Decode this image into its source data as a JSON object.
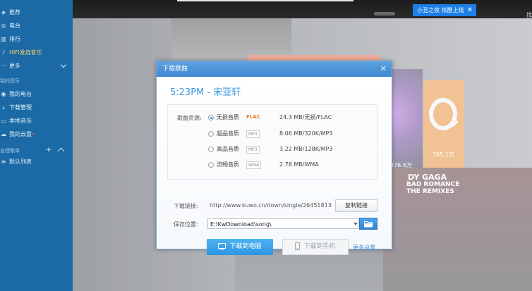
{
  "sidebar": {
    "items_top": [
      {
        "label": "推荐",
        "icon": "tag-icon"
      },
      {
        "label": "电台",
        "icon": "radio-icon"
      },
      {
        "label": "排行",
        "icon": "chart-icon"
      },
      {
        "label": "HiFi发烧音乐",
        "icon": "hifi-icon"
      },
      {
        "label": "更多",
        "icon": "more-icon"
      }
    ],
    "my_music_title": "我的音乐",
    "my_music_items": [
      {
        "label": "我的电台",
        "icon": "radio-icon"
      },
      {
        "label": "下载管理",
        "icon": "download-icon"
      },
      {
        "label": "本地音乐",
        "icon": "monitor-icon"
      },
      {
        "label": "我的云盘",
        "icon": "cloud-icon"
      }
    ],
    "playlist_title": "自建歌单",
    "playlist_items": [
      {
        "label": "默认列表",
        "icon": "list-icon"
      }
    ]
  },
  "notification": {
    "text": "小丑之夜 炫酷上线",
    "close": "✕"
  },
  "top_right_text": "找",
  "background": {
    "count_1": "376.6万",
    "count_2": "365.1万",
    "album_text_1": "DY GAGA",
    "album_text_2": "BAD ROMANCE",
    "album_text_3": "THE REMIXES"
  },
  "dialog": {
    "title": "下载歌曲",
    "close": "✕",
    "song": "5:23PM - 宋亚轩",
    "quality_label": "歌曲资源:",
    "qualities": [
      {
        "name": "无损音质",
        "format": "FLAC",
        "size": "24.3 MB/无损/FLAC",
        "selected": true
      },
      {
        "name": "超品音质",
        "format": "MP3",
        "size": "8.06 MB/320K/MP3",
        "selected": false
      },
      {
        "name": "高品音质",
        "format": "MP3",
        "size": "3.22 MB/128K/MP3",
        "selected": false
      },
      {
        "name": "流畅音质",
        "format": "WMA",
        "size": "2.78 MB/WMA",
        "selected": false
      }
    ],
    "link_label": "下载链接:",
    "link_url": "http://www.kuwo.cn/down/single/26451813",
    "copy_button": "复制链接",
    "save_label": "保存位置:",
    "save_path": "E:\\KwDownload\\song\\",
    "download_pc": "下载到电脑",
    "download_phone": "下载到手机",
    "more_settings": "更多设置"
  },
  "colors": {
    "sidebar": "#1b6aa6",
    "accent": "#3b9ae0",
    "notify": "#1d7fe6",
    "flac": "#e8792c"
  }
}
